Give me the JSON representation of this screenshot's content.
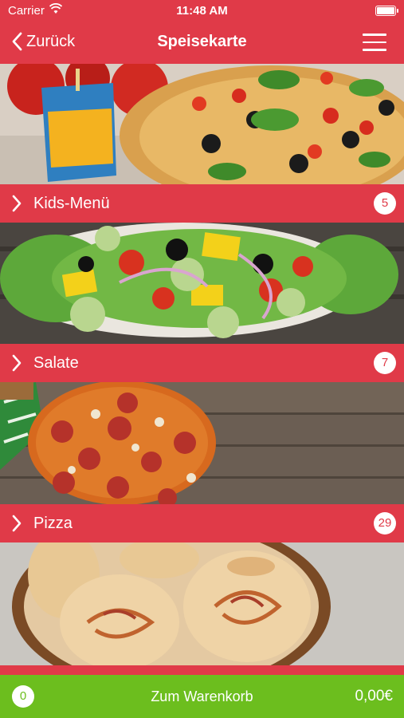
{
  "status_bar": {
    "carrier": "Carrier",
    "time": "11:48 AM"
  },
  "nav": {
    "back_label": "Zurück",
    "title": "Speisekarte"
  },
  "categories": [
    {
      "label": "Kids-Menü",
      "count": "5"
    },
    {
      "label": "Salate",
      "count": "7"
    },
    {
      "label": "Pizza",
      "count": "29"
    }
  ],
  "cart": {
    "count": "0",
    "label": "Zum Warenkorb",
    "total": "0,00€"
  },
  "colors": {
    "accent": "#e03a48",
    "cart_green": "#6cbe1e"
  }
}
